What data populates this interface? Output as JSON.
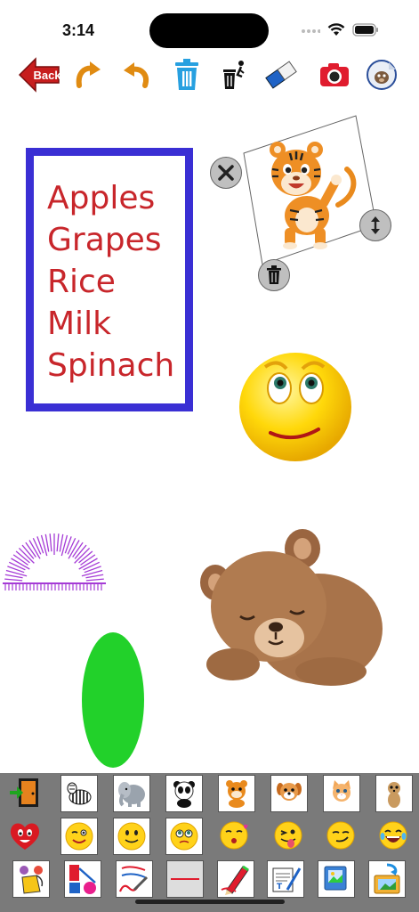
{
  "status_bar": {
    "time": "3:14"
  },
  "toolbar": {
    "back_label": "Back",
    "buttons": [
      "back-button",
      "redo-button",
      "undo-button",
      "trash-button",
      "clear-all-button",
      "eraser-button",
      "camera-button",
      "sticker-button"
    ]
  },
  "canvas": {
    "list_items": [
      "Apples",
      "Grapes",
      "Rice",
      "Milk",
      "Spinach"
    ],
    "colors": {
      "box_border": "#3a2fd4",
      "list_text": "#c8262b",
      "green_oval": "#22d12a",
      "protractor": "#a53bd6"
    }
  },
  "palette": {
    "row1": [
      "exit-door-icon",
      "zebra-icon",
      "elephant-icon",
      "panda-icon",
      "tiger-cub-icon",
      "puppy-icon",
      "kitten-icon",
      "meerkat-icon"
    ],
    "row2": [
      "heart-emoji-icon",
      "wink-emoji-icon",
      "smile-emoji-icon",
      "pleading-emoji-icon",
      "kiss-emoji-icon",
      "tongue-emoji-icon",
      "smirk-emoji-icon",
      "laughing-emoji-icon"
    ],
    "row3": [
      "paint-bucket-icon",
      "shapes-icon",
      "pen-draw-icon",
      "line-icon",
      "pencil-icon",
      "text-icon",
      "photo-library-icon",
      "import-image-icon"
    ]
  }
}
